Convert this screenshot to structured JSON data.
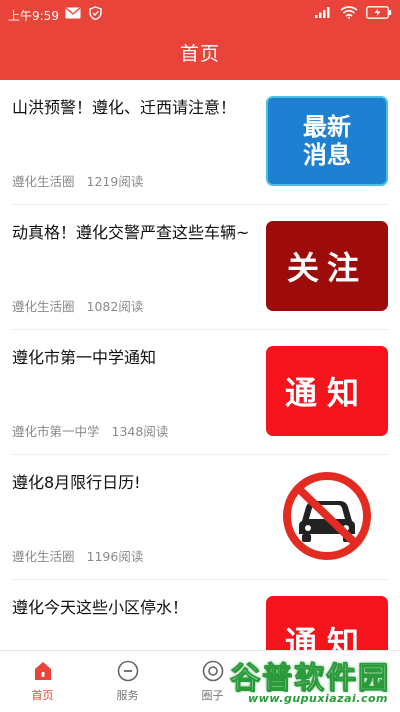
{
  "status_bar": {
    "time": "上午9:59",
    "battery": "",
    "icons_left": [
      "mail-icon",
      "shield-icon"
    ],
    "icons_right": [
      "signal-icon",
      "wifi-icon",
      "battery-icon"
    ]
  },
  "header": {
    "title": "首页"
  },
  "feed": {
    "items": [
      {
        "title": "山洪预警！遵化、迁西请注意！",
        "source": "遵化生活圈",
        "reads": "1219阅读",
        "thumb_text": "最新消息"
      },
      {
        "title": "动真格！遵化交警严查这些车辆~",
        "source": "遵化生活圈",
        "reads": "1082阅读",
        "thumb_text": "关注"
      },
      {
        "title": "遵化市第一中学通知",
        "source": "遵化市第一中学",
        "reads": "1348阅读",
        "thumb_text": "通知"
      },
      {
        "title": "遵化8月限行日历!",
        "source": "遵化生活圈",
        "reads": "1196阅读",
        "thumb_text": ""
      },
      {
        "title": "遵化今天这些小区停水！",
        "source": "",
        "reads": "",
        "thumb_text": "通知"
      }
    ]
  },
  "tabbar": {
    "tabs": [
      {
        "label": "首页",
        "icon": "home-icon"
      },
      {
        "label": "服务",
        "icon": "service-icon"
      },
      {
        "label": "圈子",
        "icon": "circle-icon"
      }
    ]
  },
  "watermark": {
    "brand": "谷普软件园",
    "url": "www.gupuxiazai.com"
  },
  "colors": {
    "accent": "#e8443a",
    "thumb_blue": "#1f7fd1",
    "thumb_dark_red": "#9e0b0b",
    "thumb_red": "#f5141c"
  }
}
